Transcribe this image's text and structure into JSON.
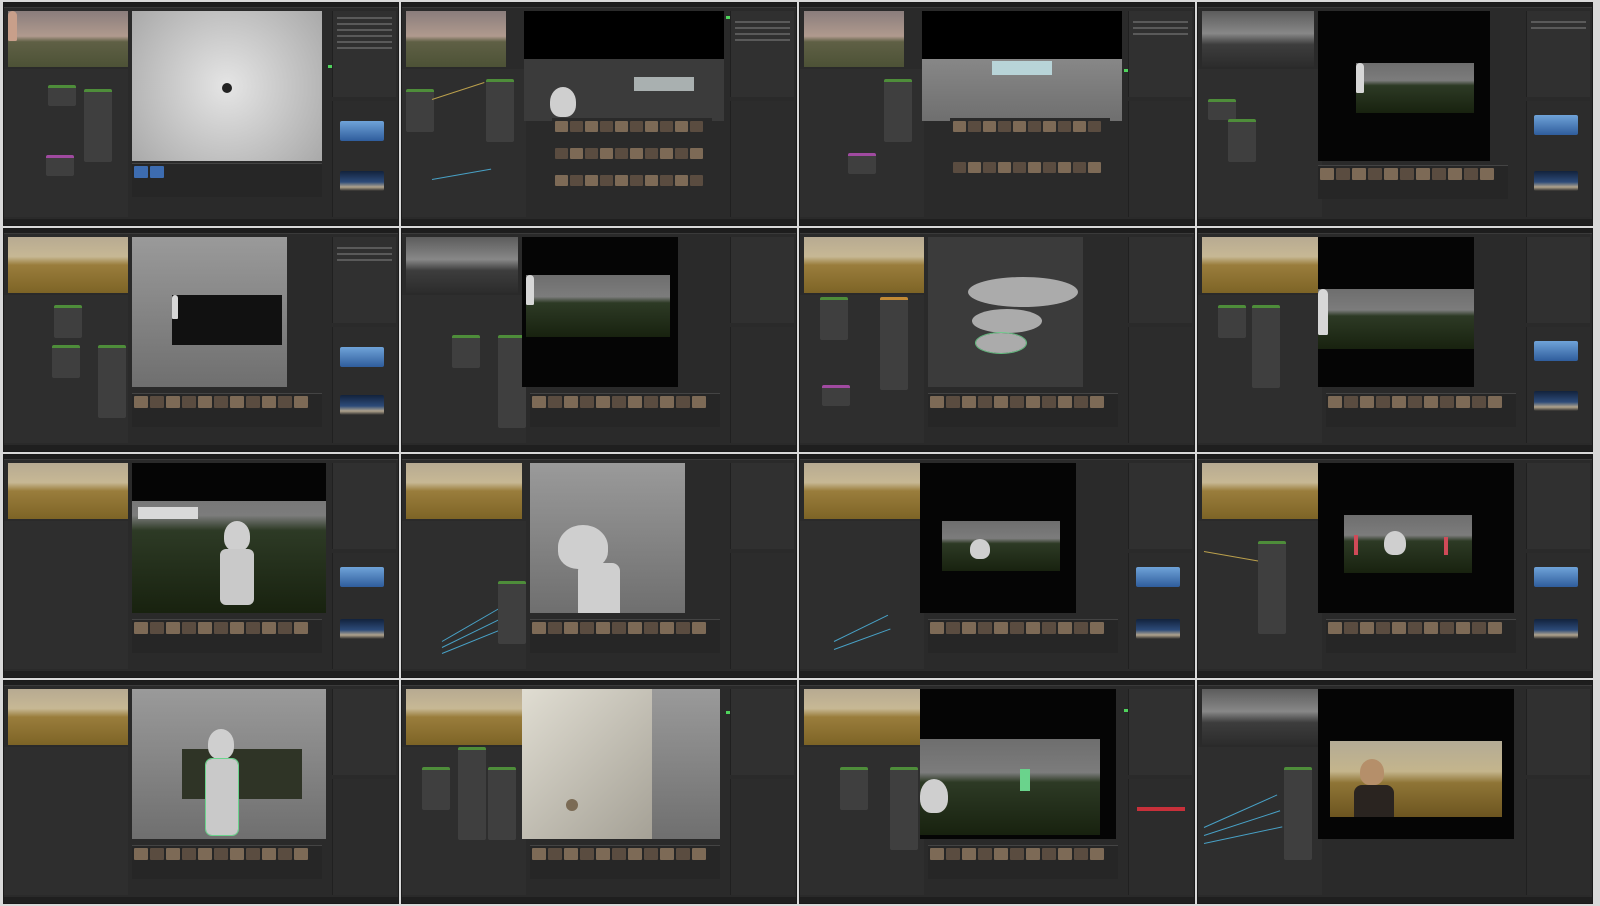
{
  "sheet": {
    "thumbnails": [
      {
        "ref": "dusk",
        "view": "snow",
        "props_swatch": "sky"
      },
      {
        "ref": "dusk",
        "view": "dark",
        "props_swatch": "none",
        "library": true
      },
      {
        "ref": "dusk",
        "view": "gray",
        "props_swatch": "none",
        "library": true
      },
      {
        "ref": "mono",
        "view": "black",
        "props_swatch": "sky"
      },
      {
        "ref": "field",
        "view": "gray",
        "props_swatch": "sky"
      },
      {
        "ref": "mono",
        "view": "black",
        "props_swatch": "none"
      },
      {
        "ref": "field",
        "view": "dark",
        "props_swatch": "none"
      },
      {
        "ref": "field",
        "view": "black",
        "props_swatch": "sky"
      },
      {
        "ref": "field",
        "view": "render",
        "props_swatch": "sky"
      },
      {
        "ref": "field",
        "view": "gray",
        "props_swatch": "none"
      },
      {
        "ref": "field",
        "view": "black",
        "props_swatch": "sky"
      },
      {
        "ref": "field",
        "view": "black",
        "props_swatch": "sky"
      },
      {
        "ref": "field",
        "view": "gray",
        "props_swatch": "none"
      },
      {
        "ref": "field",
        "view": "gray",
        "props_swatch": "none"
      },
      {
        "ref": "field",
        "view": "black",
        "props_swatch": "none"
      },
      {
        "ref": "mono",
        "view": "black",
        "props_swatch": "none"
      }
    ]
  },
  "colors": {
    "accent_green": "#4fd35c",
    "node_wire_blue": "#48a1c6",
    "node_wire_yellow": "#bba04c",
    "ui_dark": "#2a2a2a",
    "sheet_background": "#d9d9d9"
  },
  "icons": [
    "expand-icon",
    "eye-icon",
    "camera-icon",
    "sun-icon"
  ]
}
